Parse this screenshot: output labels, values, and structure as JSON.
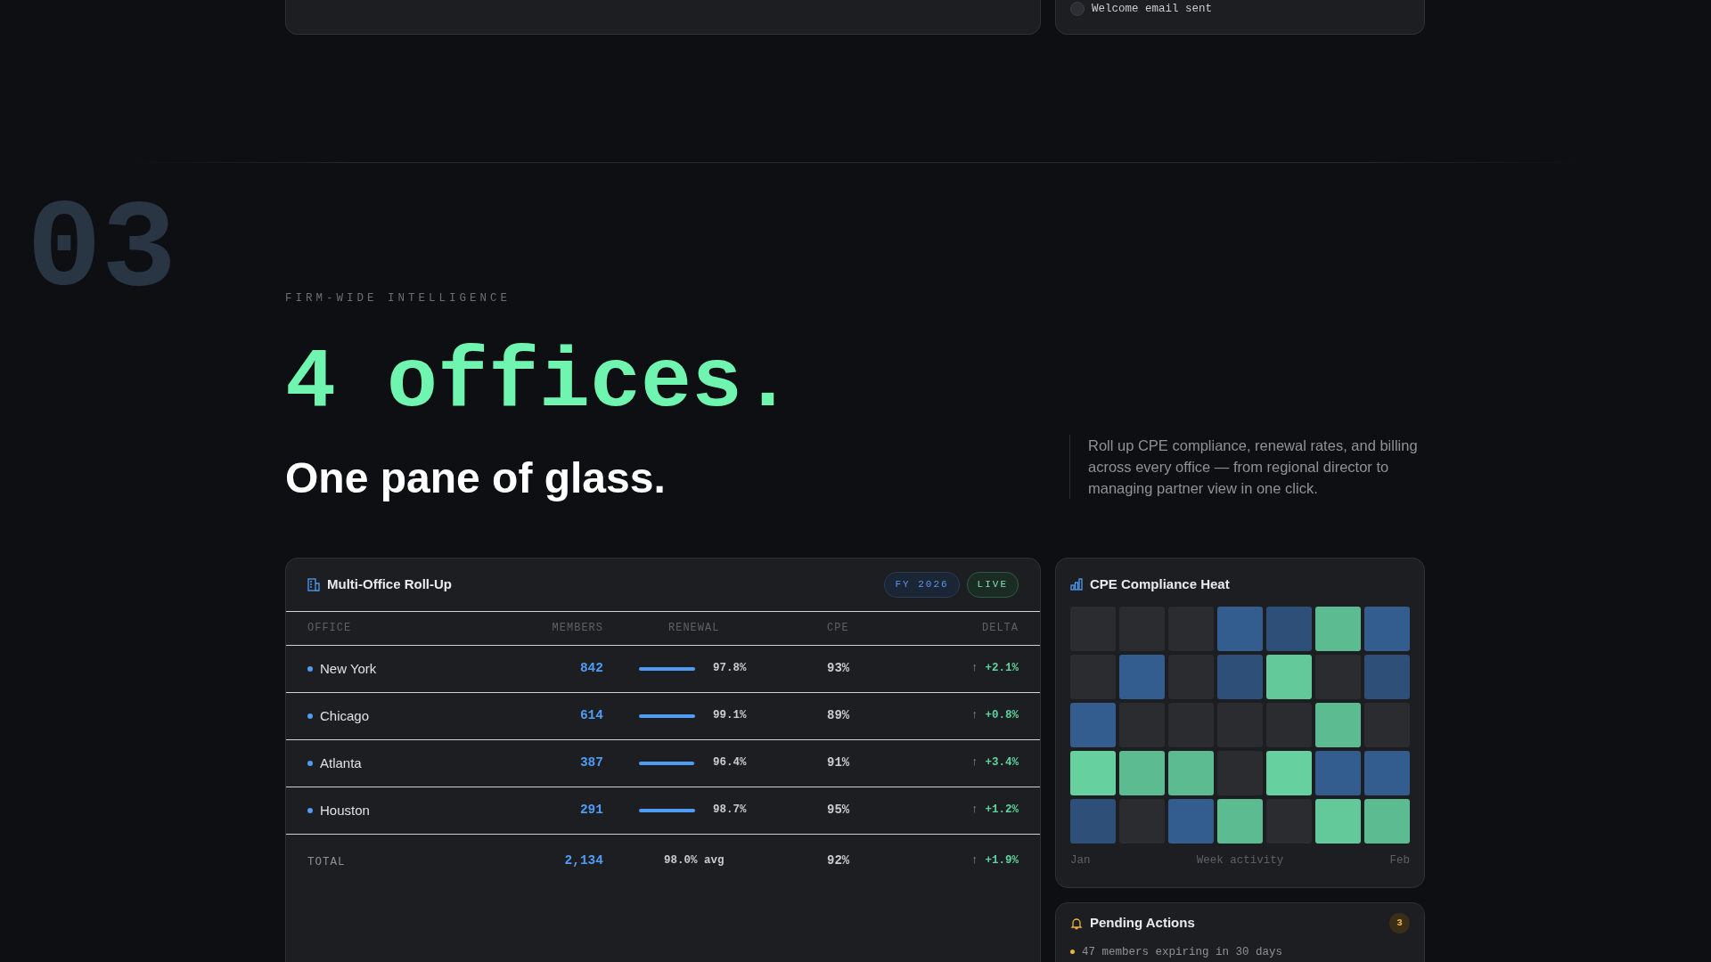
{
  "previous_cards": {
    "checklist_item": {
      "label": "Welcome email sent",
      "checked": false
    }
  },
  "section": {
    "number": "03",
    "eyebrow": "FIRM-WIDE INTELLIGENCE",
    "headline": "4 offices.",
    "subheadline": "One pane of glass.",
    "description": "Roll up CPE compliance, renewal rates, and billing across every office — from regional director to managing partner view in one click."
  },
  "rollup": {
    "title": "Multi-Office Roll-Up",
    "badges": [
      {
        "label": "FY 2026",
        "kind": "period"
      },
      {
        "label": "LIVE",
        "kind": "live"
      }
    ],
    "columns": [
      "OFFICE",
      "MEMBERS",
      "RENEWAL",
      "CPE",
      "DELTA"
    ],
    "rows": [
      {
        "office": "New York",
        "members": "842",
        "level": 0.978,
        "renewal": "97.8%",
        "cpe": "93%",
        "delta_arrow": "↑",
        "delta": "+2.1%"
      },
      {
        "office": "Chicago",
        "members": "614",
        "level": 0.991,
        "renewal": "99.1%",
        "cpe": "89%",
        "delta_arrow": "↑",
        "delta": "+0.8%"
      },
      {
        "office": "Atlanta",
        "members": "387",
        "level": 0.964,
        "renewal": "96.4%",
        "cpe": "91%",
        "delta_arrow": "↑",
        "delta": "+3.4%"
      },
      {
        "office": "Houston",
        "members": "291",
        "level": 0.987,
        "renewal": "98.7%",
        "cpe": "95%",
        "delta_arrow": "↑",
        "delta": "+1.2%"
      }
    ],
    "total": {
      "label": "TOTAL",
      "members": "2,134",
      "renewal": "98.0% avg",
      "cpe": "92%",
      "delta_arrow": "↑",
      "delta": "+1.9%"
    }
  },
  "heat": {
    "title": "CPE Compliance Heat",
    "cells": [
      {
        "color": "#2a2c30"
      },
      {
        "color": "#2a2c30"
      },
      {
        "color": "#2a2c30"
      },
      {
        "color": "#335d8e"
      },
      {
        "color": "#2e5078"
      },
      {
        "color": "#5dbb92"
      },
      {
        "color": "#335d8e"
      },
      {
        "color": "#2a2c30"
      },
      {
        "color": "#335d8e"
      },
      {
        "color": "#2a2c30"
      },
      {
        "color": "#2e5078"
      },
      {
        "color": "#63c99a"
      },
      {
        "color": "#2a2c30"
      },
      {
        "color": "#2e5078"
      },
      {
        "color": "#335d8e"
      },
      {
        "color": "#2a2c30"
      },
      {
        "color": "#2a2c30"
      },
      {
        "color": "#2a2c30"
      },
      {
        "color": "#2a2c30"
      },
      {
        "color": "#5dbb92"
      },
      {
        "color": "#2a2c30"
      },
      {
        "color": "#66d19e"
      },
      {
        "color": "#5dbb92"
      },
      {
        "color": "#5dbb92"
      },
      {
        "color": "#2a2c30"
      },
      {
        "color": "#66d19e"
      },
      {
        "color": "#335d8e"
      },
      {
        "color": "#335d8e"
      },
      {
        "color": "#2e5078"
      },
      {
        "color": "#2a2c30"
      },
      {
        "color": "#335d8e"
      },
      {
        "color": "#5dbb92"
      },
      {
        "color": "#2a2c30"
      },
      {
        "color": "#63c99a"
      },
      {
        "color": "#5dbb92"
      }
    ],
    "axis_start": "Jan",
    "axis_label": "Week activity",
    "axis_end": "Feb"
  },
  "pending": {
    "title": "Pending Actions",
    "count": "3",
    "items": [
      "47 members expiring in 30 days"
    ]
  }
}
